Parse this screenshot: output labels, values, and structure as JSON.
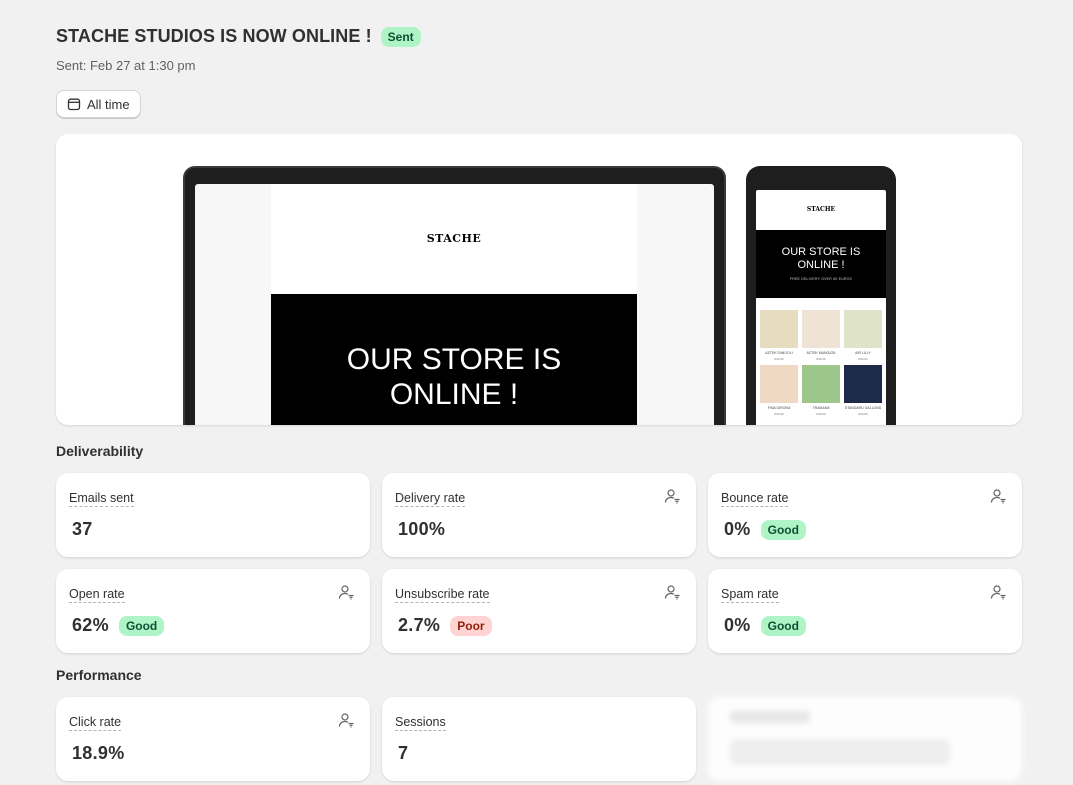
{
  "campaign": {
    "title": "STACHE STUDIOS IS NOW ONLINE !",
    "status": "Sent",
    "sent_line": "Sent: Feb 27 at 1:30 pm"
  },
  "filter": {
    "label": "All time",
    "icon": "calendar-icon"
  },
  "preview": {
    "brand": "STACHE",
    "hero_line1": "OUR STORE IS",
    "hero_line2": "ONLINE !",
    "mobile_sub": "FREE DELIVERY OVER 60 EUROS",
    "products": [
      {
        "name": "AZTEK FANGOLI",
        "price": "€30.00",
        "color": "#e8dcc0"
      },
      {
        "name": "AZTEK MANGATA",
        "price": "€30.00",
        "color": "#efe3d6"
      },
      {
        "name": "AIR LILLY",
        "price": "€30.00",
        "color": "#dfe4c8"
      },
      {
        "name": "FINA GIRONA",
        "price": "€30.00",
        "color": "#f0d9c4"
      },
      {
        "name": "TRAMJAM",
        "price": "€30.00",
        "color": "#9cc68a"
      },
      {
        "name": "STANDARD GALLONS",
        "price": "€30.00",
        "color": "#1d2a4a"
      }
    ]
  },
  "deliverability": {
    "title": "Deliverability",
    "metrics": [
      {
        "label": "Emails sent",
        "value": "37",
        "badge": "",
        "has_icon": false
      },
      {
        "label": "Delivery rate",
        "value": "100%",
        "badge": "",
        "has_icon": true
      },
      {
        "label": "Bounce rate",
        "value": "0%",
        "badge": "Good",
        "has_icon": true
      },
      {
        "label": "Open rate",
        "value": "62%",
        "badge": "Good",
        "has_icon": true
      },
      {
        "label": "Unsubscribe rate",
        "value": "2.7%",
        "badge": "Poor",
        "has_icon": true
      },
      {
        "label": "Spam rate",
        "value": "0%",
        "badge": "Good",
        "has_icon": true
      }
    ]
  },
  "performance": {
    "title": "Performance",
    "metrics": [
      {
        "label": "Click rate",
        "value": "18.9%",
        "badge": "",
        "has_icon": true
      },
      {
        "label": "Sessions",
        "value": "7",
        "badge": "",
        "has_icon": false
      }
    ]
  },
  "colors": {
    "good_bg": "#aff4c6",
    "poor_bg": "#fed3d1",
    "page_bg": "#f1f1f1"
  }
}
